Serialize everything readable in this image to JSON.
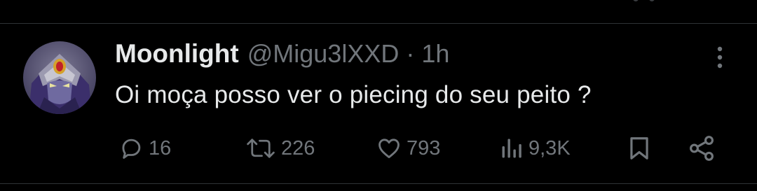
{
  "tweet": {
    "author_name": "Moonlight",
    "handle": "@Migu3lXXD",
    "separator": "·",
    "time": "1h",
    "text": "Oi moça posso ver o piecing do seu peito ?",
    "stats": {
      "replies": "16",
      "reposts": "226",
      "likes": "793",
      "views": "9,3K"
    }
  },
  "icons": {
    "reply": "reply-icon",
    "repost": "repost-icon",
    "like": "heart-icon",
    "views": "views-icon",
    "bookmark": "bookmark-icon",
    "share": "share-icon",
    "more": "more-icon"
  },
  "colors": {
    "background": "#000000",
    "text": "#e7e9ea",
    "muted": "#71767b",
    "divider": "#2f3336"
  }
}
